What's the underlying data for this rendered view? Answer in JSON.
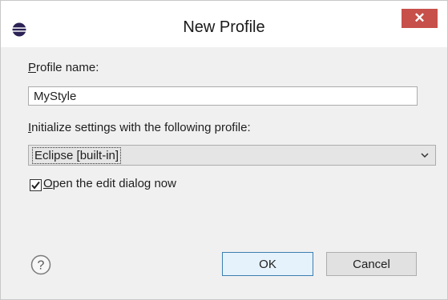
{
  "window": {
    "title": "New Profile",
    "close_glyph": "✕"
  },
  "icons": {
    "app": "eclipse-icon",
    "close": "close-icon",
    "help": "help-icon",
    "dropdown": "chevron-down-icon"
  },
  "form": {
    "profile_name_label_accel": "P",
    "profile_name_label_rest": "rofile name:",
    "profile_name_value": "MyStyle",
    "init_label_accel": "I",
    "init_label_rest": "nitialize settings with the following profile:",
    "init_selected": "Eclipse [built-in]",
    "open_edit_checked": true,
    "open_edit_accel": "O",
    "open_edit_rest": "pen the edit dialog now"
  },
  "buttons": {
    "ok": "OK",
    "cancel": "Cancel"
  },
  "colors": {
    "close_button": "#c7504a",
    "ok_border": "#3c7fb1"
  }
}
